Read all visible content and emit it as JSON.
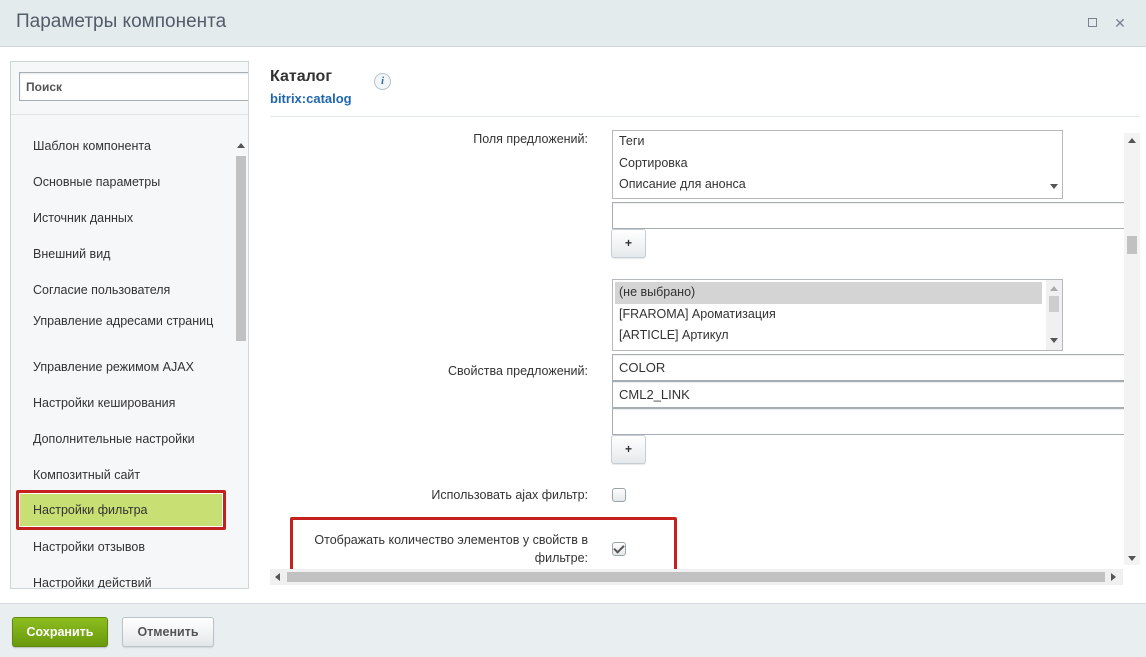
{
  "window": {
    "title": "Параметры компонента"
  },
  "sidebar": {
    "search_placeholder": "Поиск",
    "items": [
      {
        "label": "Шаблон компонента"
      },
      {
        "label": "Основные параметры"
      },
      {
        "label": "Источник данных"
      },
      {
        "label": "Внешний вид"
      },
      {
        "label": "Согласие пользователя"
      },
      {
        "label": "Управление адресами страниц"
      },
      {
        "label": "Управление режимом AJAX"
      },
      {
        "label": "Настройки кеширования"
      },
      {
        "label": "Дополнительные настройки"
      },
      {
        "label": "Композитный сайт"
      },
      {
        "label": "Настройки фильтра",
        "active": true
      },
      {
        "label": "Настройки отзывов"
      },
      {
        "label": "Настройки действий"
      }
    ]
  },
  "component": {
    "title": "Каталог",
    "code": "bitrix:catalog",
    "info_icon": "info-icon"
  },
  "form": {
    "offer_fields": {
      "label": "Поля предложений:",
      "options": [
        "Теги",
        "Сортировка",
        "Описание для анонса"
      ],
      "input_value": "",
      "add_label": "+"
    },
    "offer_props": {
      "label": "Свойства предложений:",
      "options": [
        "(не выбрано)",
        "[FRAROMA] Ароматизация",
        "[ARTICLE] Артикул"
      ],
      "selected_option": "(не выбрано)",
      "values": [
        "COLOR",
        "CML2_LINK",
        ""
      ],
      "add_label": "+"
    },
    "ajax_filter": {
      "label": "Использовать ajax фильтр:",
      "checked": false
    },
    "show_count": {
      "label": "Отображать количество элементов у свойств в фильтре:",
      "checked": true
    }
  },
  "footer": {
    "save_label": "Сохранить",
    "cancel_label": "Отменить"
  },
  "colors": {
    "accent_green": "#c8df74",
    "highlight_red": "#c3211e",
    "link_blue": "#2067b0",
    "save_green": "#7aab17"
  }
}
